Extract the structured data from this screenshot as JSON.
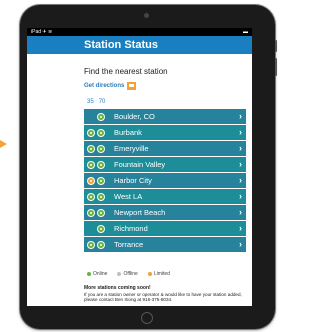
{
  "colors": {
    "accent": "#1a7fc0",
    "row_a": "#27829b",
    "row_b": "#1e8d9a",
    "online": "#67b33d",
    "offline": "#b9c2c2",
    "limited": "#f0a430",
    "link": "#2a7bbd"
  },
  "statusbar": {
    "left": "iPad ✈ ≋",
    "right": "▬"
  },
  "header": {
    "title": "Station Status"
  },
  "find": {
    "label": "Find the nearest station"
  },
  "directions": {
    "label": "Get directions",
    "icon": "map-pin-icon"
  },
  "zoom": {
    "a": "35",
    "b": "70"
  },
  "stations": [
    {
      "name": "Boulder, CO",
      "dots": [
        "hidden",
        "online"
      ]
    },
    {
      "name": "Burbank",
      "dots": [
        "online",
        "online"
      ]
    },
    {
      "name": "Emeryville",
      "dots": [
        "online",
        "online"
      ]
    },
    {
      "name": "Fountain Valley",
      "dots": [
        "online",
        "online"
      ]
    },
    {
      "name": "Harbor City",
      "dots": [
        "limited",
        "online"
      ]
    },
    {
      "name": "West LA",
      "dots": [
        "online",
        "online"
      ]
    },
    {
      "name": "Newport Beach",
      "dots": [
        "online",
        "online"
      ]
    },
    {
      "name": "Richmond",
      "dots": [
        "hidden",
        "online"
      ]
    },
    {
      "name": "Torrance",
      "dots": [
        "online",
        "online"
      ]
    }
  ],
  "legend": {
    "online": "Online",
    "offline": "Offline",
    "limited": "Limited"
  },
  "more": {
    "title": "More stations coming soon!",
    "text": "If you are a station owner or operator & would like to have your station added, please contact Ben Xiong at 916-375-8034."
  }
}
